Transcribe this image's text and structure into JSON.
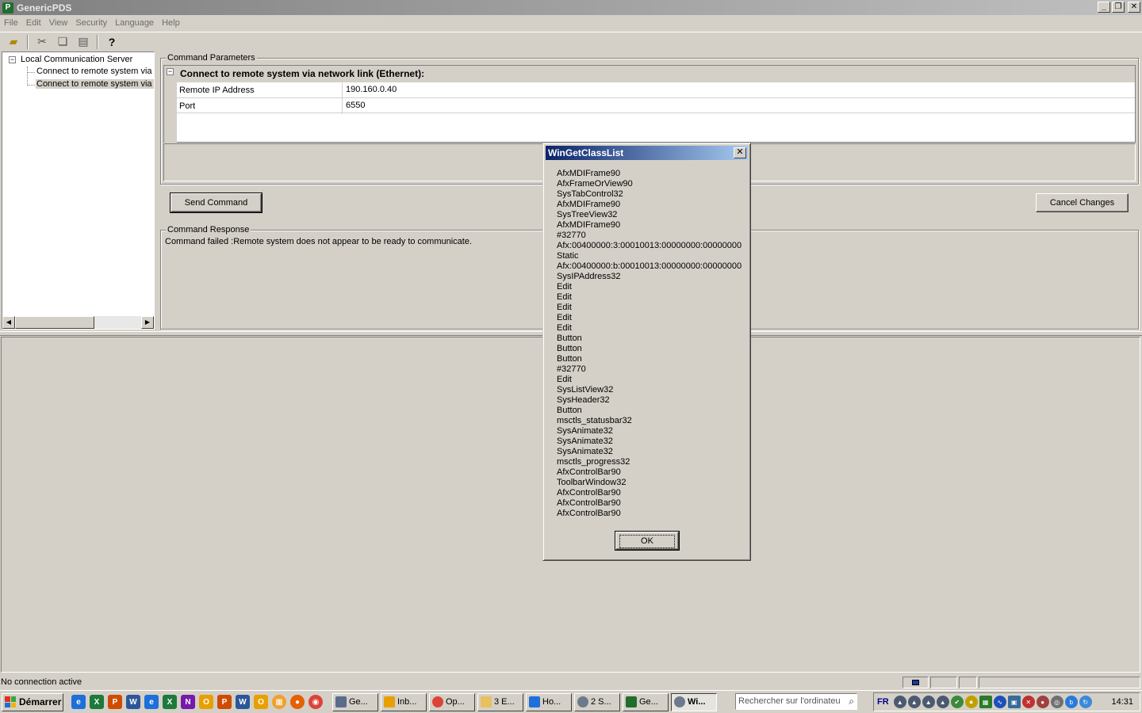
{
  "window": {
    "title": "GenericPDS",
    "app_icon": "P"
  },
  "menu": [
    "File",
    "Edit",
    "View",
    "Security",
    "Language",
    "Help"
  ],
  "tree": {
    "root": "Local Communication Server",
    "children": [
      "Connect to remote system via s",
      "Connect to remote system via n"
    ]
  },
  "params": {
    "group_label": "Command Parameters",
    "category": "Connect to remote system via network link (Ethernet):",
    "rows": [
      {
        "name": "Remote IP Address",
        "value": "190.160.0.40"
      },
      {
        "name": "Port",
        "value": "6550"
      }
    ]
  },
  "buttons": {
    "send": "Send Command",
    "cancel": "Cancel Changes"
  },
  "response": {
    "group_label": "Command Response",
    "text": "Command failed :Remote system does not appear to be ready to communicate."
  },
  "status": {
    "text": "No connection active"
  },
  "dialog": {
    "title": "WinGetClassList",
    "close": "✕",
    "ok": "OK",
    "classes": [
      "AfxMDIFrame90",
      "AfxFrameOrView90",
      "SysTabControl32",
      "AfxMDIFrame90",
      "SysTreeView32",
      "AfxMDIFrame90",
      "#32770",
      "Afx:00400000:3:00010013:00000000:00000000",
      "Static",
      "Afx:00400000:b:00010013:00000000:00000000",
      "SysIPAddress32",
      "Edit",
      "Edit",
      "Edit",
      "Edit",
      "Edit",
      "Button",
      "Button",
      "Button",
      "#32770",
      "Edit",
      "SysListView32",
      "SysHeader32",
      "Button",
      "msctls_statusbar32",
      "SysAnimate32",
      "SysAnimate32",
      "SysAnimate32",
      "msctls_progress32",
      "AfxControlBar90",
      "ToolbarWindow32",
      "AfxControlBar90",
      "AfxControlBar90",
      "AfxControlBar90"
    ]
  },
  "taskbar": {
    "start": "Démarrer",
    "tasks": [
      {
        "label": "Ge...",
        "color": "#5a6b8c"
      },
      {
        "label": "Inb...",
        "color": "#e8a000"
      },
      {
        "label": "Op...",
        "color": "#db4437"
      },
      {
        "label": "3 E...",
        "color": "#e8c060"
      },
      {
        "label": "Ho...",
        "color": "#1e6fd9"
      },
      {
        "label": "2 S...",
        "color": "#6b7a8c"
      },
      {
        "label": "Ge...",
        "color": "#1f6e2e"
      },
      {
        "label": "Wi...",
        "color": "#6b7a8c"
      }
    ],
    "search_placeholder": "Rechercher sur l'ordinateu",
    "lang": "FR",
    "clock": "14:31"
  },
  "colors": {
    "title_active": "#0a246a",
    "face": "#d4d0c8"
  }
}
